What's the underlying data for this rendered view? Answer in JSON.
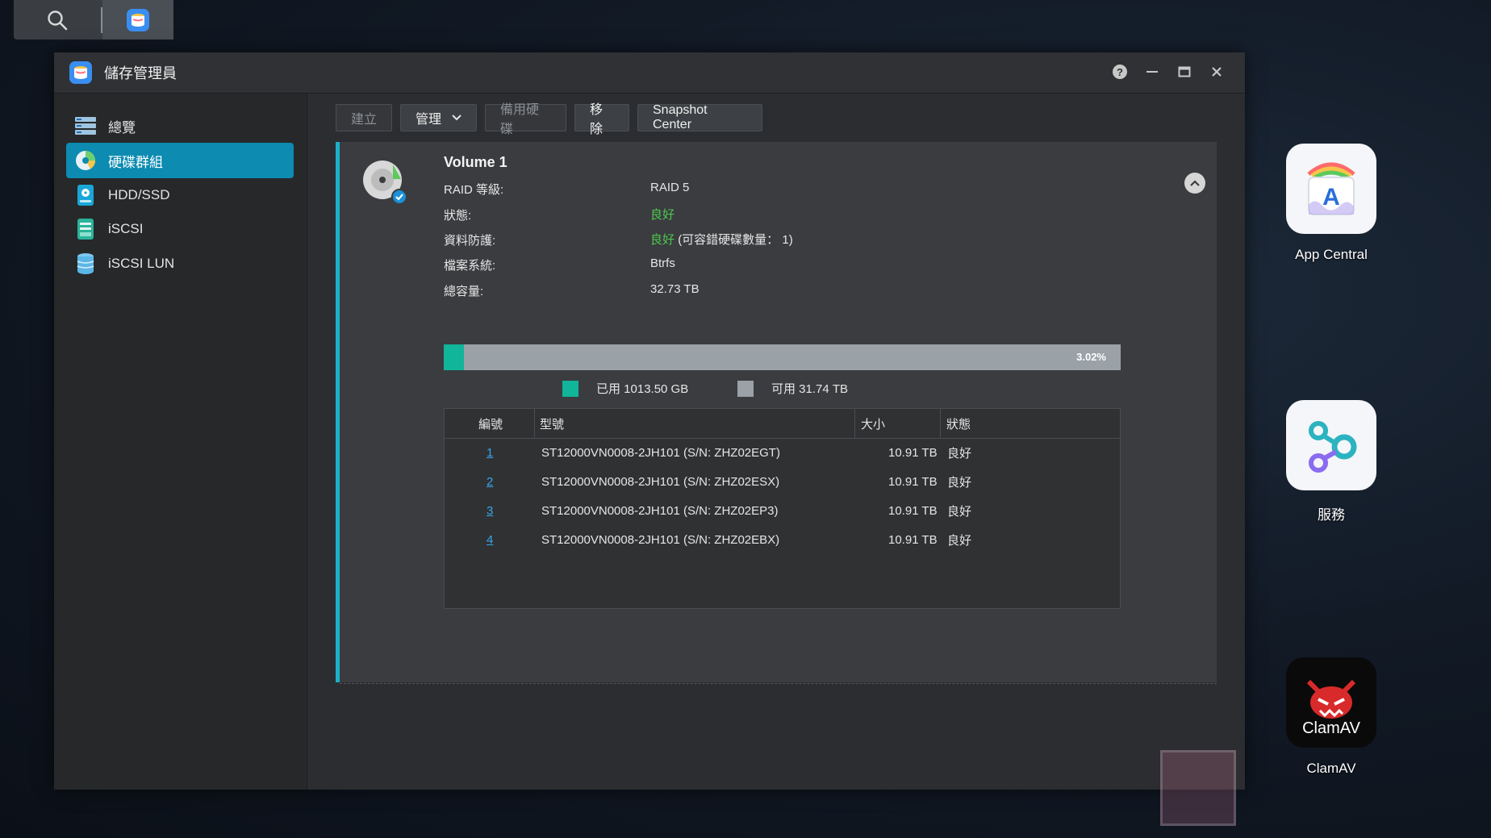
{
  "window": {
    "title": "儲存管理員"
  },
  "sidebar": {
    "items": [
      {
        "label": "總覽",
        "icon": "overview-icon"
      },
      {
        "label": "硬碟群組",
        "icon": "volume-icon",
        "active": true
      },
      {
        "label": "HDD/SSD",
        "icon": "hdd-icon"
      },
      {
        "label": "iSCSI",
        "icon": "iscsi-icon"
      },
      {
        "label": "iSCSI LUN",
        "icon": "iscsi-lun-icon"
      }
    ]
  },
  "toolbar": {
    "create_label": "建立",
    "manage_label": "管理",
    "spare_label": "備用硬碟",
    "remove_label": "移除",
    "snapshot_label": "Snapshot Center"
  },
  "volume": {
    "title": "Volume 1",
    "props": [
      {
        "label": "RAID 等級:",
        "value": "RAID 5"
      },
      {
        "label": "狀態:",
        "value": "良好"
      },
      {
        "label": "資料防護:",
        "value": "良好",
        "extra": "(可容錯硬碟數量： 1)"
      },
      {
        "label": "檔案系統:",
        "value": "Btrfs"
      },
      {
        "label": "總容量:",
        "value": "32.73 TB"
      }
    ],
    "usage": {
      "percent_label": "3.02%",
      "used_fraction": 0.0302,
      "used_label": "已用 1013.50 GB",
      "free_label": "可用 31.74 TB"
    },
    "table": {
      "headers": {
        "num": "編號",
        "model": "型號",
        "size": "大小",
        "status": "狀態"
      },
      "rows": [
        {
          "num": "1",
          "model": "ST12000VN0008-2JH101 (S/N: ZHZ02EGT)",
          "size": "10.91 TB",
          "status": "良好"
        },
        {
          "num": "2",
          "model": "ST12000VN0008-2JH101 (S/N: ZHZ02ESX)",
          "size": "10.91 TB",
          "status": "良好"
        },
        {
          "num": "3",
          "model": "ST12000VN0008-2JH101 (S/N: ZHZ02EP3)",
          "size": "10.91 TB",
          "status": "良好"
        },
        {
          "num": "4",
          "model": "ST12000VN0008-2JH101 (S/N: ZHZ02EBX)",
          "size": "10.91 TB",
          "status": "良好"
        }
      ]
    }
  },
  "desktop": {
    "apps": [
      {
        "label": "App Central",
        "icon": "app-central-icon"
      },
      {
        "label": "服務",
        "icon": "services-icon"
      },
      {
        "label": "ClamAV",
        "icon": "clamav-icon",
        "logo_text": "ClamAV"
      }
    ]
  },
  "colors": {
    "accent": "#0d8bb1",
    "used": "#10b59a",
    "free": "#9aa1a7",
    "good": "#4ec94e",
    "link": "#3ba6e8"
  }
}
